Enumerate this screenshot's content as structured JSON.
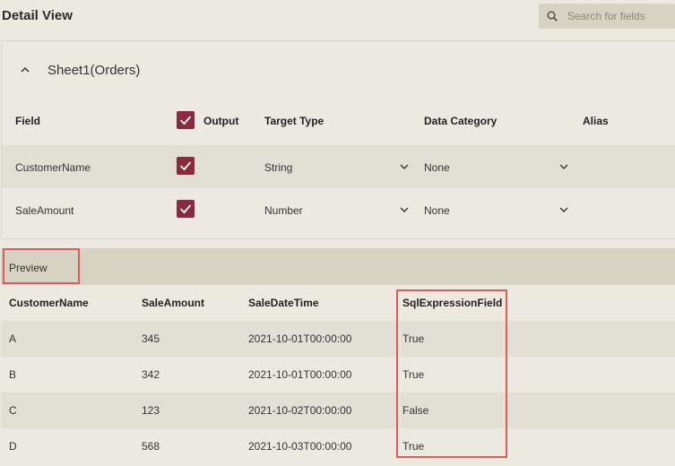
{
  "header": {
    "title": "Detail View",
    "search_placeholder": "Search for fields"
  },
  "sheet": {
    "name": "Sheet1(Orders)",
    "columns": {
      "field": "Field",
      "output": "Output",
      "target_type": "Target Type",
      "data_category": "Data Category",
      "alias": "Alias"
    },
    "fields": [
      {
        "name": "CustomerName",
        "output": true,
        "target_type": "String",
        "data_category": "None"
      },
      {
        "name": "SaleAmount",
        "output": true,
        "target_type": "Number",
        "data_category": "None"
      }
    ]
  },
  "preview": {
    "label": "Preview",
    "columns": [
      "CustomerName",
      "SaleAmount",
      "SaleDateTime",
      "SqlExpressionField"
    ],
    "rows": [
      [
        "A",
        "345",
        "2021-10-01T00:00:00",
        "True"
      ],
      [
        "B",
        "342",
        "2021-10-01T00:00:00",
        "True"
      ],
      [
        "C",
        "123",
        "2021-10-02T00:00:00",
        "False"
      ],
      [
        "D",
        "568",
        "2021-10-03T00:00:00",
        "True"
      ]
    ]
  },
  "colors": {
    "accent": "#8b2a3f",
    "highlight": "#e05b5b",
    "background": "#ece9e1",
    "bar": "#d6d3c2"
  },
  "icons": {
    "search": "search-icon",
    "collapse": "chevron-up-icon",
    "dropdown": "chevron-down-icon",
    "checkbox": "checkmark-icon"
  }
}
